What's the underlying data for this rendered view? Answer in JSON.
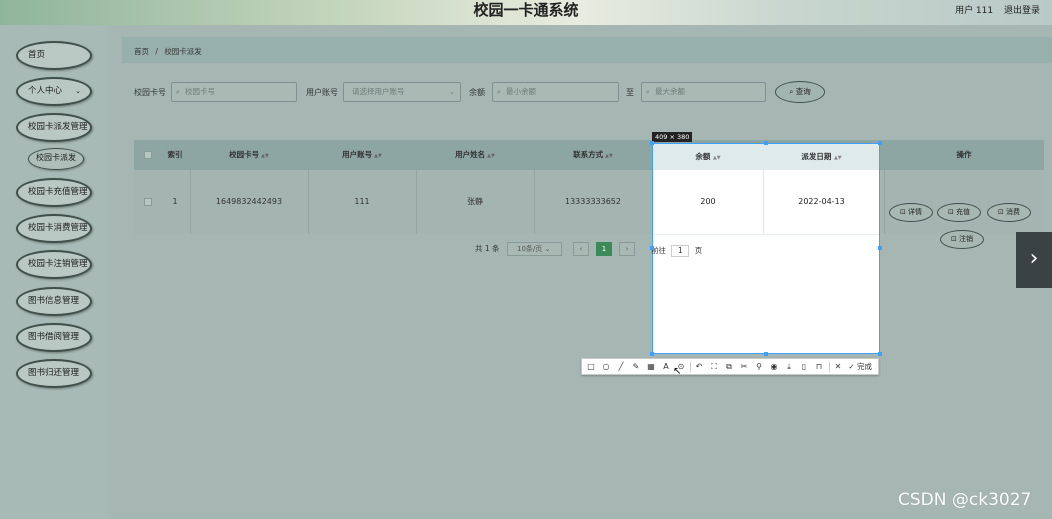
{
  "header": {
    "title": "校园一卡通系统",
    "user": "用户 111",
    "logout": "退出登录"
  },
  "sidebar": {
    "items": [
      {
        "label": "首页"
      },
      {
        "label": "个人中心"
      },
      {
        "label": "校园卡派发管理"
      },
      {
        "label": "校园卡派发"
      },
      {
        "label": "校园卡充值管理"
      },
      {
        "label": "校园卡消费管理"
      },
      {
        "label": "校园卡注销管理"
      },
      {
        "label": "图书信息管理"
      },
      {
        "label": "图书借阅管理"
      },
      {
        "label": "图书归还管理"
      }
    ]
  },
  "breadcrumb": {
    "home": "首页",
    "sep": "/",
    "current": "校园卡派发"
  },
  "filters": {
    "card_label": "校园卡号",
    "card_placeholder": "校园卡号",
    "account_label": "用户账号",
    "account_placeholder": "请选择用户账号",
    "balance_label": "余额",
    "min_placeholder": "最小余额",
    "to_label": "至",
    "max_placeholder": "最大余额",
    "search_button": "查询"
  },
  "table": {
    "headers": [
      "索引",
      "校园卡号",
      "用户账号",
      "用户姓名",
      "联系方式",
      "余额",
      "派发日期",
      "操作"
    ],
    "rows": [
      {
        "index": "1",
        "card": "1649832442493",
        "account": "111",
        "name": "张静",
        "phone": "13333333652",
        "balance": "200",
        "date": "2022-04-13"
      }
    ],
    "actions": [
      "详情",
      "充值",
      "消费",
      "注销"
    ]
  },
  "pagination": {
    "total": "共 1 条",
    "page_size": "10条/页",
    "current": "1",
    "goto": "前往",
    "goto_value": "1",
    "page_unit": "页"
  },
  "screenshot_tool": {
    "size": "409 × 380",
    "done": "完成",
    "tools": [
      "rect-icon",
      "circle-icon",
      "line-icon",
      "pen-icon",
      "mosaic-icon",
      "text-icon",
      "ocr-icon",
      "undo-icon",
      "translate-icon",
      "copy-text-icon",
      "pin-icon",
      "pin-image-icon",
      "record-icon",
      "download-icon",
      "phone-icon",
      "bookmark-icon",
      "close-icon",
      "check-icon"
    ]
  },
  "nav": {
    "next": "›"
  },
  "watermark": "CSDN @ck3027"
}
